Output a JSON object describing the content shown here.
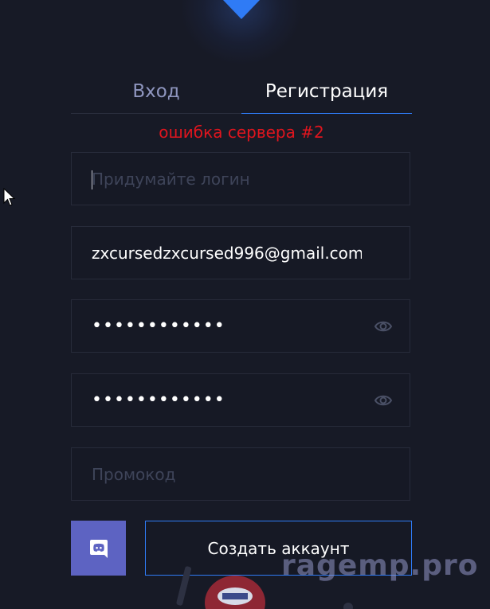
{
  "tabs": {
    "login": "Вход",
    "register": "Регистрация"
  },
  "error_text": "ошибка сервера #2",
  "fields": {
    "login_placeholder": "Придумайте логин",
    "email_value": "zxcursedzxcursed996@gmail.com",
    "password_dots": "••••••••••••",
    "confirm_dots": "••••••••••••",
    "promo_placeholder": "Промокод"
  },
  "buttons": {
    "create": "Создать аккаунт"
  },
  "icons": {
    "logo": "chevron-down-logo",
    "eye": "eye-icon",
    "discord": "discord-icon",
    "cursor": "mouse-pointer-icon"
  },
  "watermark": "ragemp.pro",
  "colors": {
    "background": "#171a26",
    "accent": "#2f7bf5",
    "error": "#e0151e",
    "discord": "#5d63c2",
    "inactive_tab": "#8f96bf",
    "placeholder": "#3e4459"
  }
}
